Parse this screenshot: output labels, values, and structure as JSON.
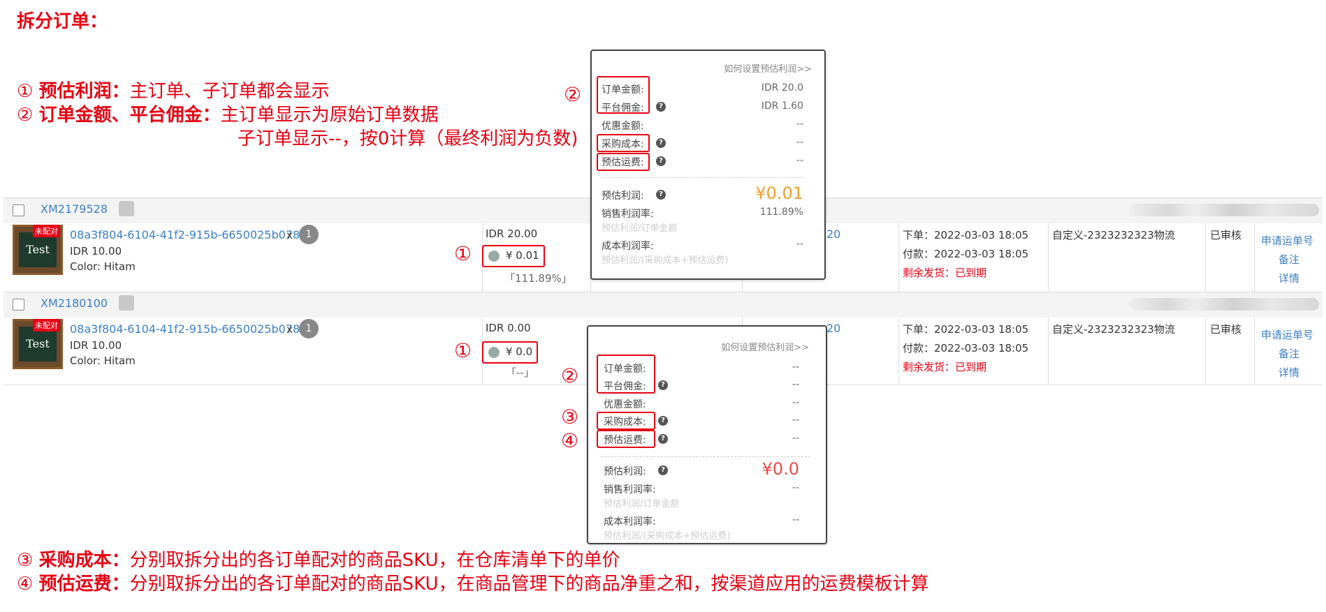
{
  "title": "拆分订单：",
  "notes": {
    "n1_num": "①",
    "n1_bold": "预估利润：",
    "n1_text": "主订单、子订单都会显示",
    "n2_num": "②",
    "n2_bold": "订单金额、平台佣金：",
    "n2_text": "主订单显示为原始订单数据",
    "n2_text2": "子订单显示--，按0计算（最终利润为负数)",
    "n3_num": "③",
    "n3_bold": "采购成本：",
    "n3_text": "分别取拆分出的各订单配对的商品SKU，在仓库清单下的单价",
    "n4_num": "④",
    "n4_bold": "预估运费：",
    "n4_text": "分别取拆分出的各订单配对的商品SKU，在商品管理下的商品净重之和，按渠道应用的运费模板计算"
  },
  "orders": [
    {
      "order_id": "XM2179528",
      "unmatched_badge": "未配对",
      "thumb_text": "Test",
      "sku": "08a3f804-6104-41f2-915b-6650025b0783",
      "times": "x",
      "qty": "1",
      "price": "IDR 10.00",
      "color": "Color:  Hitam",
      "amount": "IDR 20.00",
      "profit": "¥ 0.01",
      "margin": "「111.89%」",
      "partial_link": "20",
      "order_time": "下单：2022-03-03 18:05",
      "pay_time": "付款：2022-03-03 18:05",
      "ship_left": "剩余发货：已到期",
      "logistics": "自定义-2323232323物流",
      "status": "已审核",
      "action_apply": "申请运单号",
      "action_note": "备注",
      "action_detail": "详情",
      "marker": "①"
    },
    {
      "order_id": "XM2180100",
      "unmatched_badge": "未配对",
      "thumb_text": "Test",
      "sku": "08a3f804-6104-41f2-915b-6650025b0783",
      "times": "x",
      "qty": "1",
      "price": "IDR 10.00",
      "color": "Color:  Hitam",
      "amount": "IDR 0.00",
      "profit": "¥ 0.0",
      "margin": "「--」",
      "partial_link": "20",
      "order_time": "下单：2022-03-03 18:05",
      "pay_time": "付款：2022-03-03 18:05",
      "ship_left": "剩余发货：已到期",
      "logistics": "自定义-2323232323物流",
      "status": "已审核",
      "action_apply": "申请运单号",
      "action_note": "备注",
      "action_detail": "详情",
      "marker": "①"
    }
  ],
  "popovers": [
    {
      "help": "如何设置预估利润>>",
      "order_amount_label": "订单金额:",
      "order_amount": "IDR 20.0",
      "commission_label": "平台佣金:",
      "commission": "IDR 1.60",
      "discount_label": "优惠金额:",
      "discount": "--",
      "purchase_label": "采购成本:",
      "purchase": "--",
      "freight_label": "预估运费:",
      "freight": "--",
      "est_profit_label": "预估利润:",
      "est_profit": "¥0.01",
      "sales_margin_label": "销售利润率:",
      "sales_margin": "111.89%",
      "sales_margin_formula": "预估利润/订单金额",
      "cost_margin_label": "成本利润率:",
      "cost_margin": "--",
      "cost_margin_formula": "预估利润/(采购成本+预估运费)",
      "marker2": "②"
    },
    {
      "help": "如何设置预估利润>>",
      "order_amount_label": "订单金额:",
      "order_amount": "--",
      "commission_label": "平台佣金:",
      "commission": "--",
      "discount_label": "优惠金额:",
      "discount": "--",
      "purchase_label": "采购成本:",
      "purchase": "--",
      "freight_label": "预估运费:",
      "freight": "--",
      "est_profit_label": "预估利润:",
      "est_profit": "¥0.0",
      "sales_margin_label": "销售利润率:",
      "sales_margin": "--",
      "sales_margin_formula": "预估利润/订单金额",
      "cost_margin_label": "成本利润率:",
      "cost_margin": "--",
      "cost_margin_formula": "预估利润/(采购成本+预估运费)",
      "marker2": "②",
      "marker3": "③",
      "marker4": "④"
    }
  ],
  "colors": {
    "accent_red": "#e60012",
    "link_blue": "#3b7fc4",
    "profit_orange": "#f0a030",
    "profit_red": "#e64a4a"
  },
  "icons": {
    "help": "question-circle-icon",
    "coin": "coin-stack-icon",
    "checkbox": "checkbox-icon"
  }
}
